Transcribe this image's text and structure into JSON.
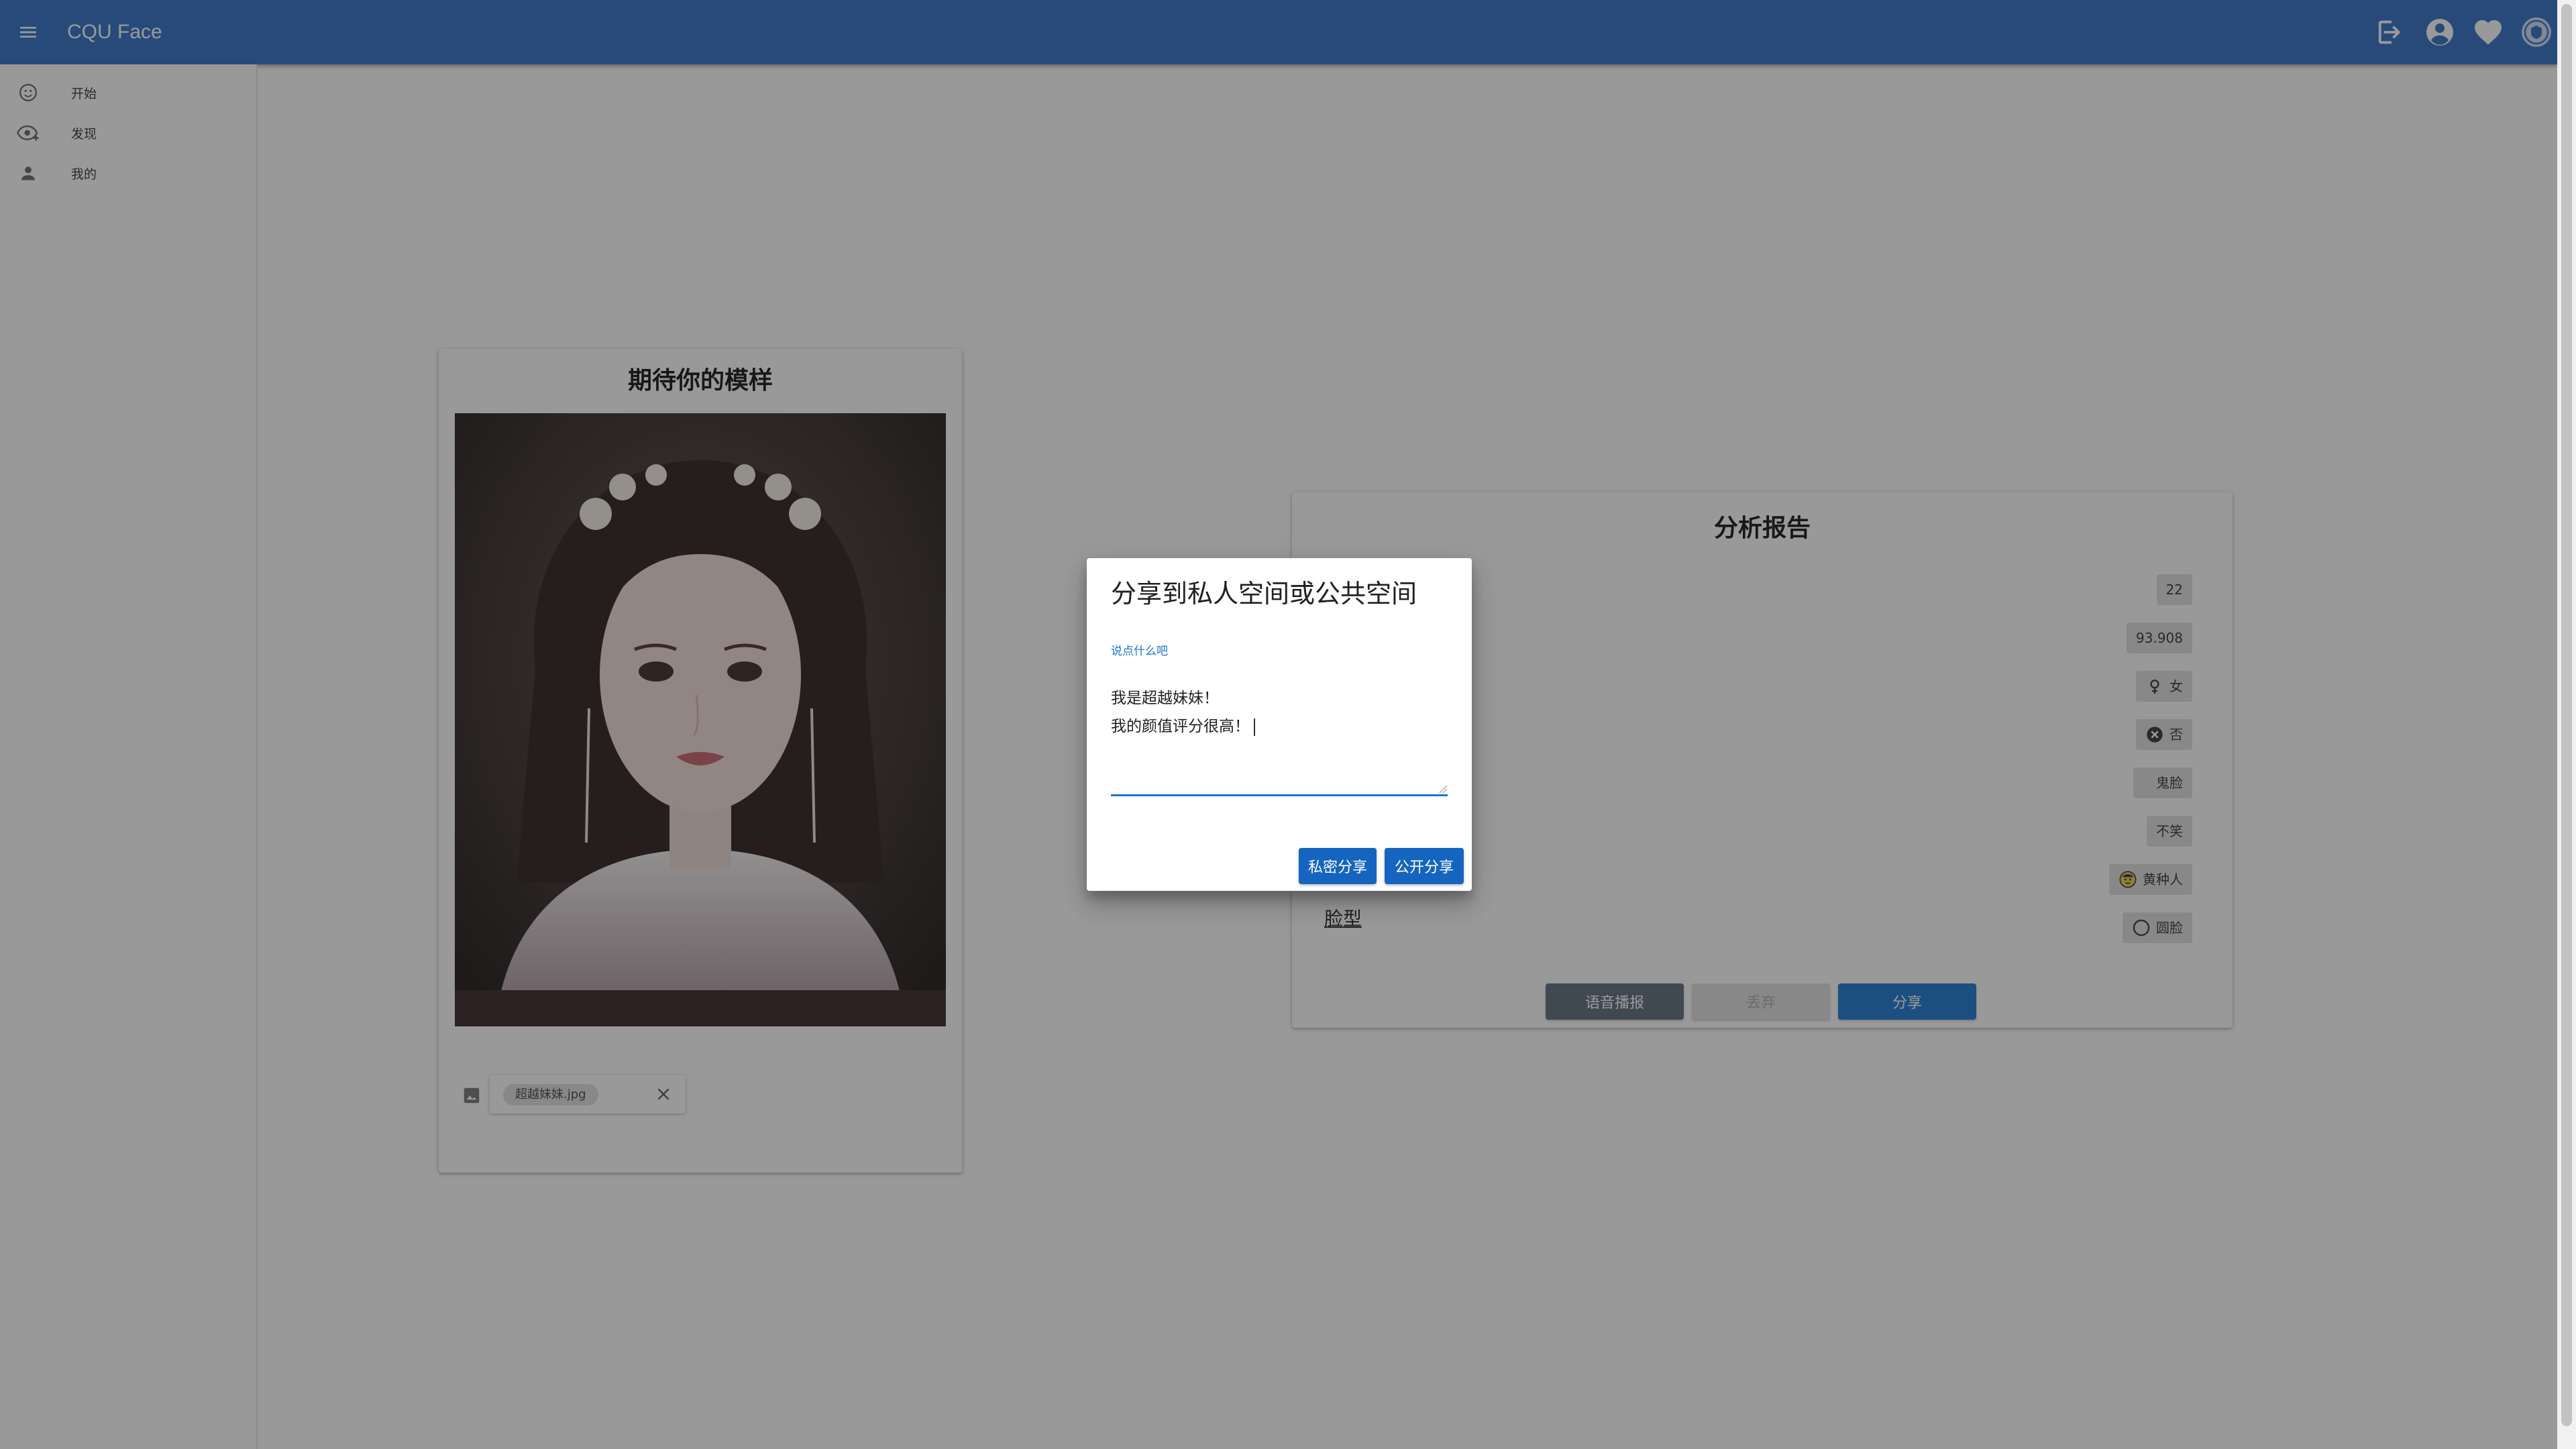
{
  "app": {
    "title": "CQU Face"
  },
  "appbar_actions": [
    "logout-icon",
    "account-icon",
    "heart-icon",
    "logo-badge-icon"
  ],
  "sidebar": {
    "items": [
      {
        "label": "开始",
        "icon": "smiley-icon"
      },
      {
        "label": "发现",
        "icon": "eye-plus-icon"
      },
      {
        "label": "我的",
        "icon": "person-icon"
      }
    ]
  },
  "upload_card": {
    "title": "期待你的模样",
    "file_chip": "超越妹妹.jpg"
  },
  "report_card": {
    "title": "分析报告",
    "tags": [
      "22",
      "93.908",
      "女",
      "否",
      "鬼脸",
      "不笑",
      "黄种人",
      "圆脸"
    ],
    "face_shape_label": "脸型",
    "buttons": {
      "voice": "语音播报",
      "discard": "丢弃",
      "share": "分享"
    }
  },
  "dialog": {
    "title": "分享到私人空间或公共空间",
    "field_label": "说点什么吧",
    "field_value": "我是超越妹妹！\n我的颜值评分很高！",
    "buttons": {
      "private": "私密分享",
      "public": "公开分享"
    }
  },
  "colors": {
    "appbar": "#2e6ec7",
    "primary": "#1976d2",
    "dialog_button": "#1565c0"
  }
}
